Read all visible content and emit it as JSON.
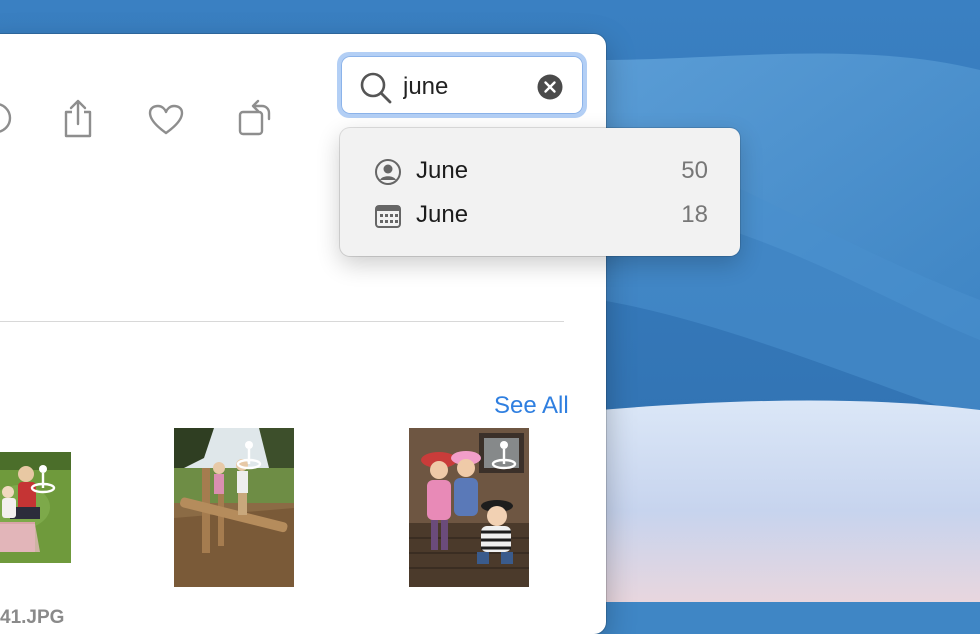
{
  "search": {
    "value": "june",
    "placeholder": "Search"
  },
  "suggestions": [
    {
      "icon": "person-icon",
      "label": "June",
      "count": "50"
    },
    {
      "icon": "calendar-icon",
      "label": "June",
      "count": "18"
    }
  ],
  "section": {
    "see_all_label": "See All"
  },
  "photos": [
    {
      "name": "41.JPG",
      "has_location": true
    },
    {
      "name": "",
      "has_location": true
    },
    {
      "name": "",
      "has_location": true
    }
  ],
  "colors": {
    "accent": "#2f7fe0",
    "focus_ring": "#b3cff5",
    "desktop": "#3f86c5"
  }
}
